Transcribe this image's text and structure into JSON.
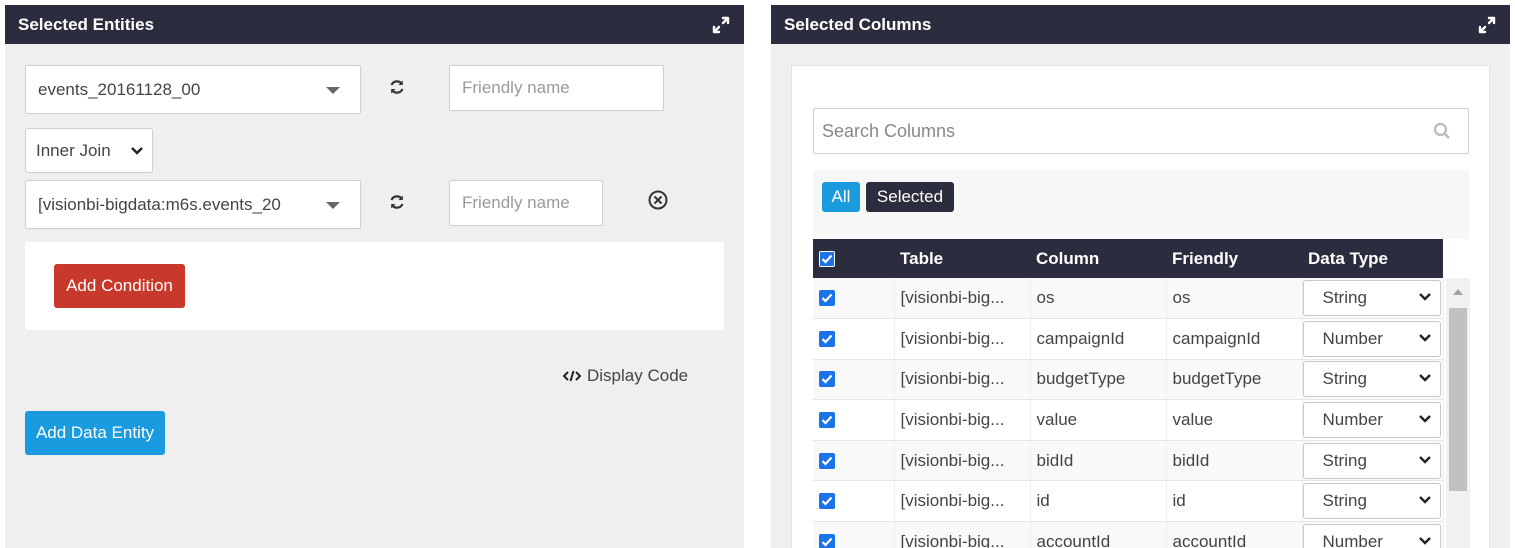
{
  "left": {
    "title": "Selected Entities",
    "entity1": {
      "value": "events_20161128_00",
      "friendly_placeholder": "Friendly name"
    },
    "join_type": "Inner Join",
    "entity2": {
      "value": "[visionbi-bigdata:m6s.events_20",
      "friendly_placeholder": "Friendly name"
    },
    "add_condition_label": "Add Condition",
    "display_code_label": "Display Code",
    "add_data_entity_label": "Add Data Entity"
  },
  "right": {
    "title": "Selected Columns",
    "search_placeholder": "Search Columns",
    "filters": {
      "all": "All",
      "selected": "Selected"
    },
    "columns": {
      "table": "Table",
      "column": "Column",
      "friendly": "Friendly",
      "data_type": "Data Type"
    },
    "rows": [
      {
        "checked": true,
        "table": "[visionbi-big...",
        "column": "os",
        "friendly": "os",
        "data_type": "String"
      },
      {
        "checked": true,
        "table": "[visionbi-big...",
        "column": "campaignId",
        "friendly": "campaignId",
        "data_type": "Number"
      },
      {
        "checked": true,
        "table": "[visionbi-big...",
        "column": "budgetType",
        "friendly": "budgetType",
        "data_type": "String"
      },
      {
        "checked": true,
        "table": "[visionbi-big...",
        "column": "value",
        "friendly": "value",
        "data_type": "Number"
      },
      {
        "checked": true,
        "table": "[visionbi-big...",
        "column": "bidId",
        "friendly": "bidId",
        "data_type": "String"
      },
      {
        "checked": true,
        "table": "[visionbi-big...",
        "column": "id",
        "friendly": "id",
        "data_type": "String"
      },
      {
        "checked": true,
        "table": "[visionbi-big...",
        "column": "accountId",
        "friendly": "accountId",
        "data_type": "Number"
      }
    ]
  },
  "colors": {
    "header_bg": "#2b2d3f",
    "primary": "#1a9be0",
    "danger": "#c9392b",
    "checkbox": "#1a73e8"
  }
}
